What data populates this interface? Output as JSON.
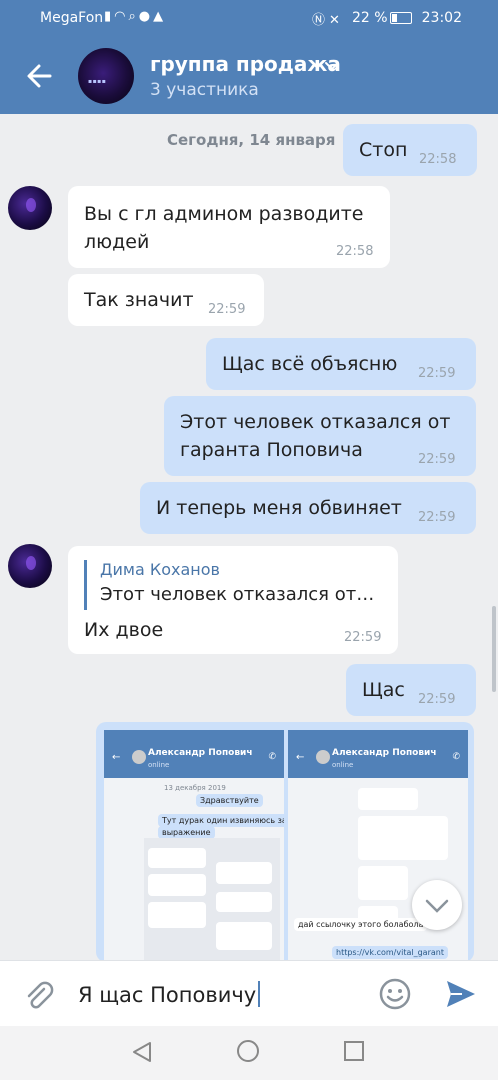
{
  "status_bar": {
    "carrier": "MegaFon",
    "battery": "22 %",
    "time": "23:02"
  },
  "header": {
    "title": "группа продажа",
    "subtitle": "3 участника"
  },
  "chat": {
    "date_separator": "Сегодня, 14 января",
    "messages": [
      {
        "text": "Стоп",
        "time": "22:58"
      },
      {
        "text_line1": "Вы с гл админом разводите",
        "text_line2": "людей",
        "time": "22:58"
      },
      {
        "text": "Так значит",
        "time": "22:59"
      },
      {
        "text": "Щас всё объясню",
        "time": "22:59"
      },
      {
        "text_line1": "Этот человек отказался от",
        "text_line2": "гаранта Поповича",
        "time": "22:59"
      },
      {
        "text": "И теперь меня обвиняет",
        "time": "22:59"
      },
      {
        "reply_name": "Дима Коханов",
        "reply_text": "Этот человек отказался от…",
        "text": "Их двое",
        "time": "22:59"
      },
      {
        "text": "Щас",
        "time": "22:59"
      }
    ],
    "screenshot": {
      "contact_name": "Александр Попович",
      "contact_status": "online",
      "date": "13 декабря 2019",
      "msg1": "Здравствуйте",
      "msg2_line1": "Тут дурак один извиняюсь за",
      "msg2_line2": "выражение",
      "msg3": "дай ссылочку этого болабола",
      "msg4": "https://vk.com/vital_garant"
    }
  },
  "composer": {
    "text": "Я щас Поповичу"
  }
}
